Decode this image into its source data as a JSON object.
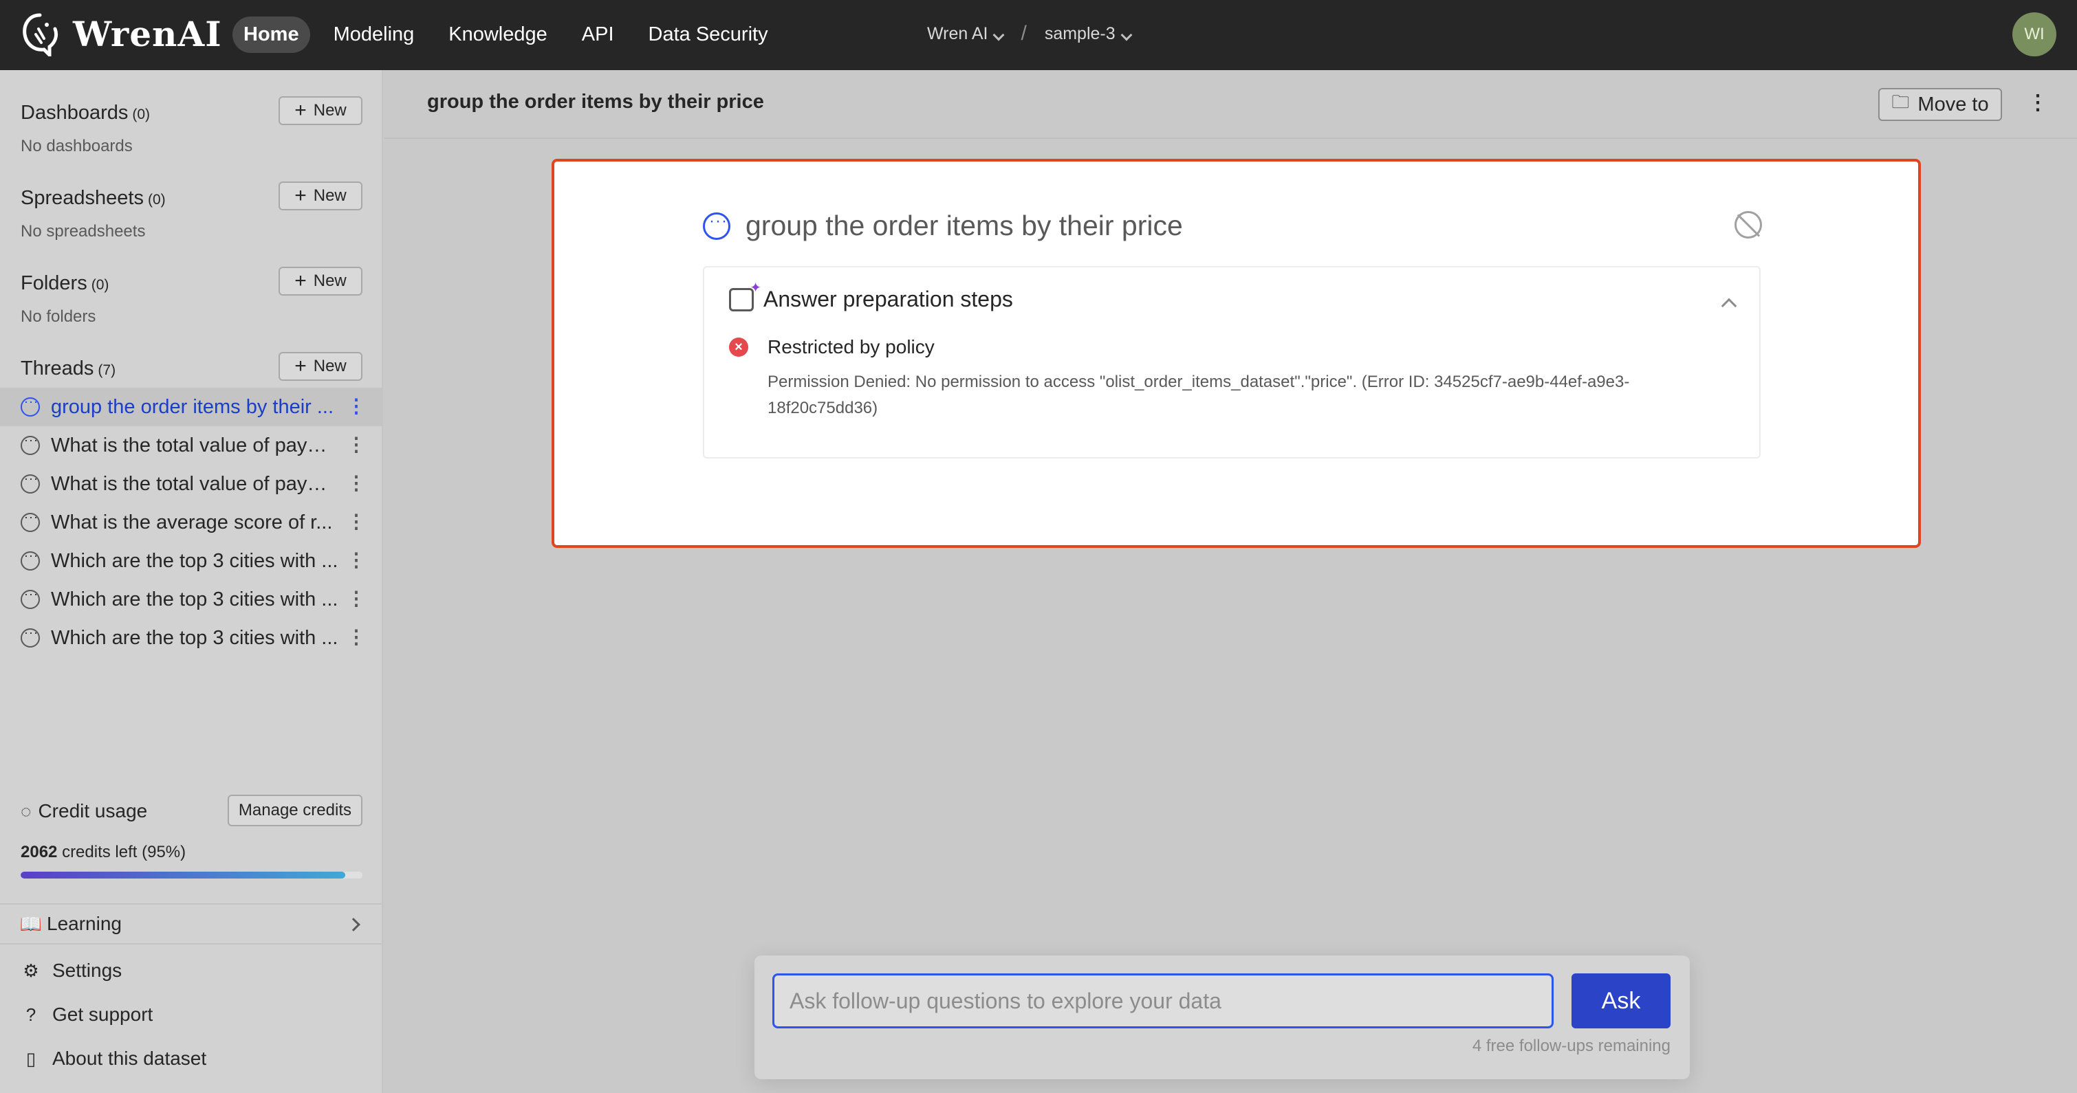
{
  "app": {
    "brand": "WrenAI",
    "nav": [
      "Home",
      "Modeling",
      "Knowledge",
      "API",
      "Data Security"
    ],
    "workspace": "Wren AI",
    "project": "sample-3",
    "user_initials": "WI"
  },
  "sidebar": {
    "dashboards": {
      "title": "Dashboards",
      "count": "(0)",
      "empty": "No dashboards",
      "new_label": "New"
    },
    "spreadsheets": {
      "title": "Spreadsheets",
      "count": "(0)",
      "empty": "No spreadsheets",
      "new_label": "New"
    },
    "folders": {
      "title": "Folders",
      "count": "(0)",
      "empty": "No folders",
      "new_label": "New"
    },
    "threads": {
      "title": "Threads",
      "count": "(7)",
      "new_label": "New",
      "items": [
        "group the order items by their ...",
        "What is the total value of paym...",
        "What is the total value of paym...",
        "What is the average score of r...",
        "Which are the top 3 cities with ...",
        "Which are the top 3 cities with ...",
        "Which are the top 3 cities with ..."
      ]
    },
    "credit": {
      "title": "Credit usage",
      "manage_label": "Manage credits",
      "credits_value": "2062",
      "credits_text": "credits left (95%)",
      "percent": 95
    },
    "learning": "Learning",
    "footer": [
      "Settings",
      "Get support",
      "About this dataset"
    ]
  },
  "main": {
    "title": "group the order items by their price",
    "move_label": "Move to",
    "question": "group the order items by their price",
    "steps_title": "Answer preparation steps",
    "error_title": "Restricted by policy",
    "error_message": "Permission Denied: No permission to access \"olist_order_items_dataset\".\"price\". (Error ID: 34525cf7-ae9b-44ef-a9e3-18f20c75dd36)"
  },
  "prompt": {
    "placeholder": "Ask follow-up questions to explore your data",
    "ask_label": "Ask",
    "remaining": "4 free follow-ups remaining"
  },
  "colors": {
    "accent": "#2f54eb",
    "highlight_border": "#e0451f",
    "error": "#e5484d"
  }
}
